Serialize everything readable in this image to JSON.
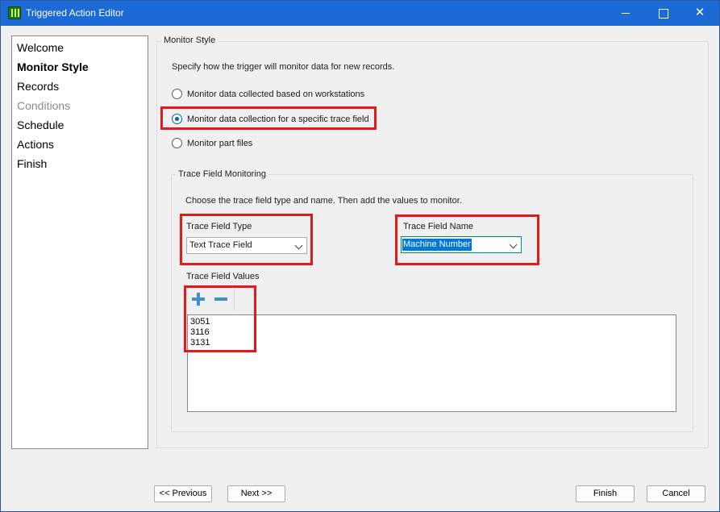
{
  "window": {
    "title": "Triggered Action Editor",
    "minimize_glyph": "",
    "maximize_glyph": "",
    "close_glyph": "✕"
  },
  "nav": {
    "items": [
      {
        "label": "Welcome",
        "state": "normal"
      },
      {
        "label": "Monitor Style",
        "state": "current"
      },
      {
        "label": "Records",
        "state": "normal"
      },
      {
        "label": "Conditions",
        "state": "disabled"
      },
      {
        "label": "Schedule",
        "state": "normal"
      },
      {
        "label": "Actions",
        "state": "normal"
      },
      {
        "label": "Finish",
        "state": "normal"
      }
    ]
  },
  "monitor_style": {
    "caption": "Monitor Style",
    "description": "Specify how the trigger will monitor data for new records.",
    "options": [
      {
        "label": "Monitor data collected based on workstations",
        "checked": false
      },
      {
        "label": "Monitor data collection for a specific trace field",
        "checked": true
      },
      {
        "label": "Monitor part files",
        "checked": false
      }
    ]
  },
  "trace_monitoring": {
    "caption": "Trace Field Monitoring",
    "description": "Choose the trace field type and name. Then add the values to monitor.",
    "type_label": "Trace Field Type",
    "type_value": "Text Trace Field",
    "name_label": "Trace Field Name",
    "name_value": "Machine Number",
    "values_label": "Trace Field Values",
    "values": [
      "3051",
      "3116",
      "3131"
    ]
  },
  "footer": {
    "previous": "<< Previous",
    "next": "Next >>",
    "finish": "Finish",
    "cancel": "Cancel"
  },
  "colors": {
    "titlebar": "#1c6ad6",
    "highlight_box": "#e01b1b",
    "accent": "#0078d7",
    "icon_blue": "#3f8fd1"
  }
}
